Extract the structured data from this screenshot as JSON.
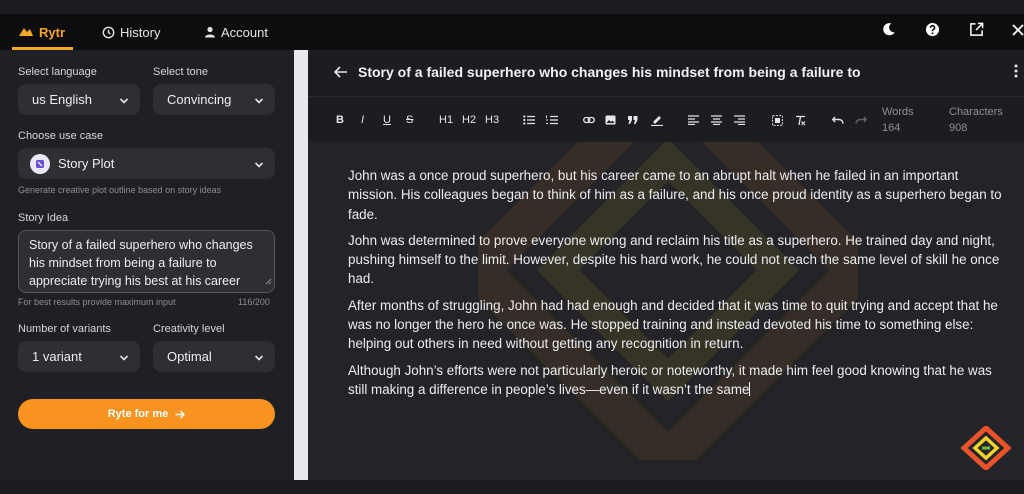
{
  "nav": {
    "rytr_label": "Rytr",
    "history_label": "History",
    "account_label": "Account"
  },
  "sidebar": {
    "language_label": "Select language",
    "language_value": "us English",
    "tone_label": "Select tone",
    "tone_value": "Convincing",
    "use_case_label": "Choose use case",
    "use_case_value": "Story Plot",
    "use_case_hint": "Generate creative plot outline based on story ideas",
    "story_idea_label": "Story Idea",
    "story_idea_value": "Story of a failed superhero who changes his mindset from being a failure to appreciate trying his best at his career",
    "story_idea_hint": "For best results provide maximum input",
    "story_idea_count": "116/200",
    "variants_label": "Number of variants",
    "variants_value": "1 variant",
    "creativity_label": "Creativity level",
    "creativity_value": "Optimal",
    "ryte_button": "Ryte for me"
  },
  "editor": {
    "title": "Story of a failed superhero who changes his mindset from being a failure to",
    "toolbar": {
      "bold": "B",
      "italic": "I",
      "underline": "U",
      "strike": "S",
      "h1": "H1",
      "h2": "H2",
      "h3": "H3"
    },
    "stats": {
      "words_label": "Words",
      "words_value": "164",
      "characters_label": "Characters",
      "characters_value": "908"
    },
    "paragraphs": [
      "John was a once proud superhero, but his career came to an abrupt halt when he failed in an important mission. His colleagues began to think of him as a failure, and his once proud identity as a superhero began to fade.",
      "John was determined to prove everyone wrong and reclaim his title as a superhero. He trained day and night, pushing himself to the limit. However, despite his hard work, he could not reach the same level of skill he once had.",
      "After months of struggling, John had had enough and decided that it was time to quit trying and accept that he was no longer the hero he once was. He stopped training and instead devoted his time to something else: helping out others in need without getting any recognition in return.",
      "Although John’s efforts were not particularly heroic or noteworthy, it made him feel good knowing that he was still making a difference in people’s lives—even if it wasn’t the same"
    ]
  },
  "colors": {
    "accent": "#f7a629",
    "button": "#f7931e",
    "sidebar_bg": "#1f2023",
    "editor_bg": "#232427",
    "navbar_bg": "#0d0d0f"
  }
}
